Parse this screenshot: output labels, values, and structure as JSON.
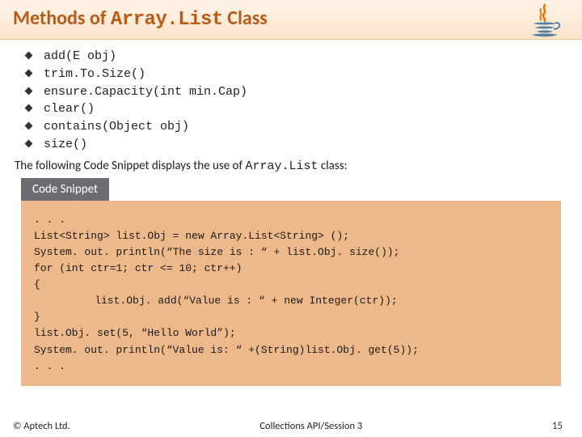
{
  "header": {
    "title_pre": "Methods of ",
    "title_code": "Array.List",
    "title_post": " Class"
  },
  "methods": [
    "add(E obj)",
    "trim.To.Size()",
    "ensure.Capacity(int min.Cap)",
    "clear()",
    "contains(Object obj)",
    "size()"
  ],
  "intro": {
    "pre": "The following Code Snippet displays the use of ",
    "code": "Array.List",
    "post": " class:"
  },
  "snippet_label": "Code Snippet",
  "code": [
    ". . .",
    "List<String> list.Obj = new Array.List<String> ();",
    "System. out. println(“The size is : “ + list.Obj. size());",
    "for (int ctr=1; ctr <= 10; ctr++)",
    "{",
    "    list.Obj. add(“Value is : “ + new Integer(ctr));",
    "}",
    "list.Obj. set(5, “Hello World”);",
    "System. out. println(“Value is: “ +(String)list.Obj. get(5));",
    ". . ."
  ],
  "footer": {
    "copyright": "© Aptech Ltd.",
    "center": "Collections API/Session 3",
    "page": "15"
  }
}
